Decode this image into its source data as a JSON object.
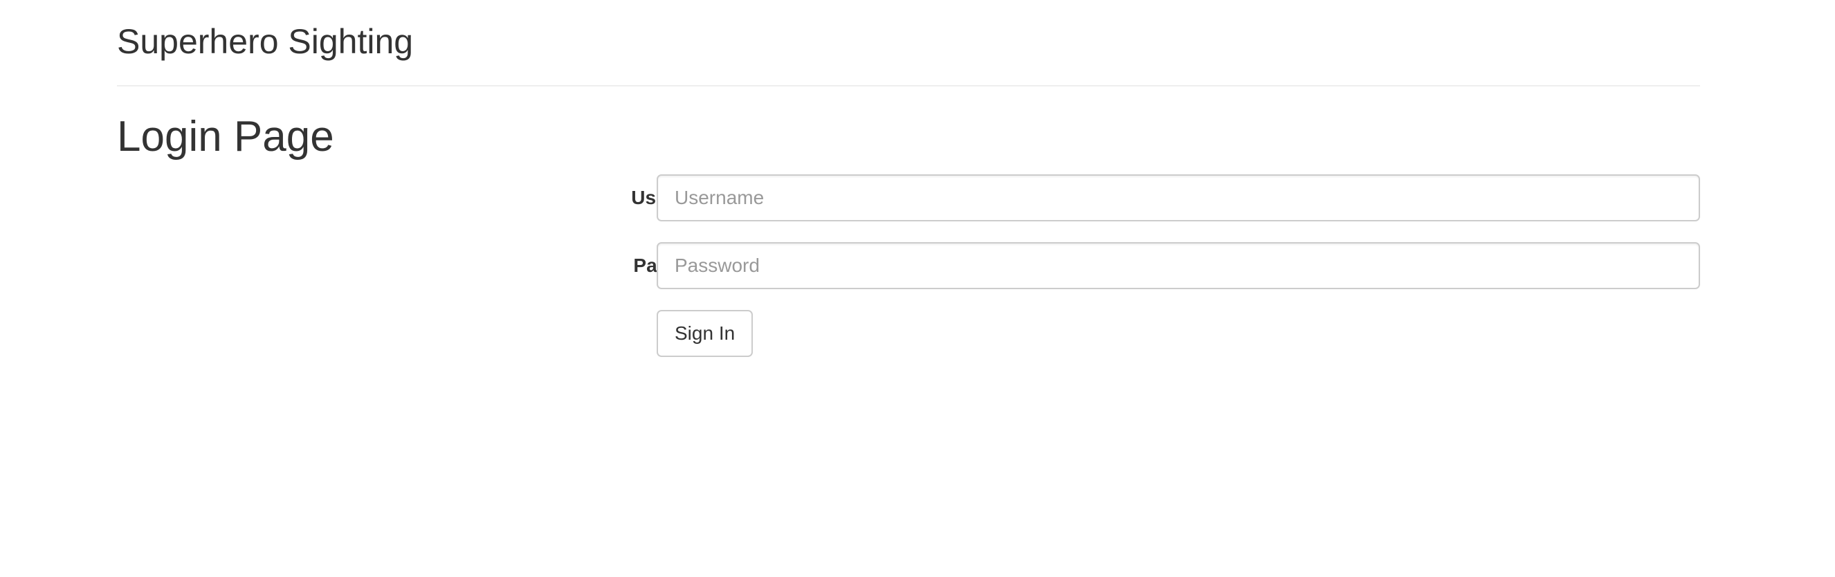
{
  "header": {
    "site_title": "Superhero Sighting"
  },
  "main": {
    "page_title": "Login Page",
    "form": {
      "username": {
        "label": "Username:",
        "placeholder": "Username",
        "value": ""
      },
      "password": {
        "label": "Password:",
        "placeholder": "Password",
        "value": ""
      },
      "submit_label": "Sign In"
    }
  },
  "colors": {
    "text": "#333333",
    "placeholder": "#999999",
    "border": "#cccccc",
    "divider": "#eeeeee",
    "background": "#ffffff"
  }
}
